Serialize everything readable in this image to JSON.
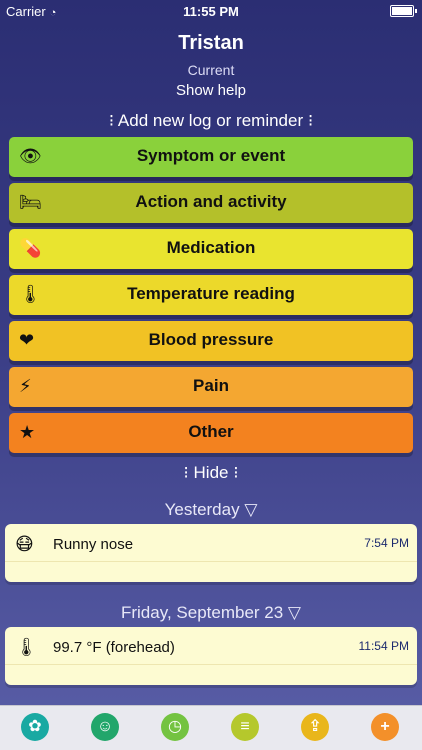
{
  "status": {
    "carrier": "Carrier",
    "time": "11:55 PM"
  },
  "header": {
    "title": "Tristan",
    "subtitle": "Current",
    "help": "Show help"
  },
  "add_new": "⁝ Add new log or reminder ⁝",
  "categories": [
    {
      "label": "Symptom or event",
      "icon": "eye-icon",
      "glyph": "👁",
      "color": "#8ad13b"
    },
    {
      "label": "Action and activity",
      "icon": "bed-icon",
      "glyph": "🛏",
      "color": "#b4c02a"
    },
    {
      "label": "Medication",
      "icon": "pill-icon",
      "glyph": "💊",
      "color": "#e9e42f"
    },
    {
      "label": "Temperature reading",
      "icon": "thermometer-icon",
      "glyph": "🌡",
      "color": "#ecd92a"
    },
    {
      "label": "Blood pressure",
      "icon": "heart-icon",
      "glyph": "❤",
      "color": "#f1c224"
    },
    {
      "label": "Pain",
      "icon": "lightning-icon",
      "glyph": "⚡",
      "color": "#f4a731"
    },
    {
      "label": "Other",
      "icon": "star-icon",
      "glyph": "★",
      "color": "#f3821f"
    }
  ],
  "hide": "⁝ Hide ⁝",
  "days": [
    {
      "label": "Yesterday ▽",
      "entries": [
        {
          "icon": "mask-face-icon",
          "glyph": "😷",
          "text": "Runny nose",
          "time": "7:54 PM"
        }
      ]
    },
    {
      "label": "Friday, September 23 ▽",
      "entries": [
        {
          "icon": "thermometer-icon",
          "glyph": "🌡",
          "text": "99.7 °F (forehead)",
          "time": "11:54 PM"
        }
      ]
    }
  ],
  "tabs": [
    {
      "icon": "sprout-icon",
      "glyph": "✿",
      "color": "#19a9a2"
    },
    {
      "icon": "group-icon",
      "glyph": "☺",
      "color": "#22a66b"
    },
    {
      "icon": "history-clock-icon",
      "glyph": "◷",
      "color": "#74c341"
    },
    {
      "icon": "filter-icon",
      "glyph": "≡",
      "color": "#b5c82c"
    },
    {
      "icon": "share-icon",
      "glyph": "⇪",
      "color": "#e9b61b"
    },
    {
      "icon": "add-icon",
      "glyph": "+",
      "color": "#f3902a"
    }
  ]
}
